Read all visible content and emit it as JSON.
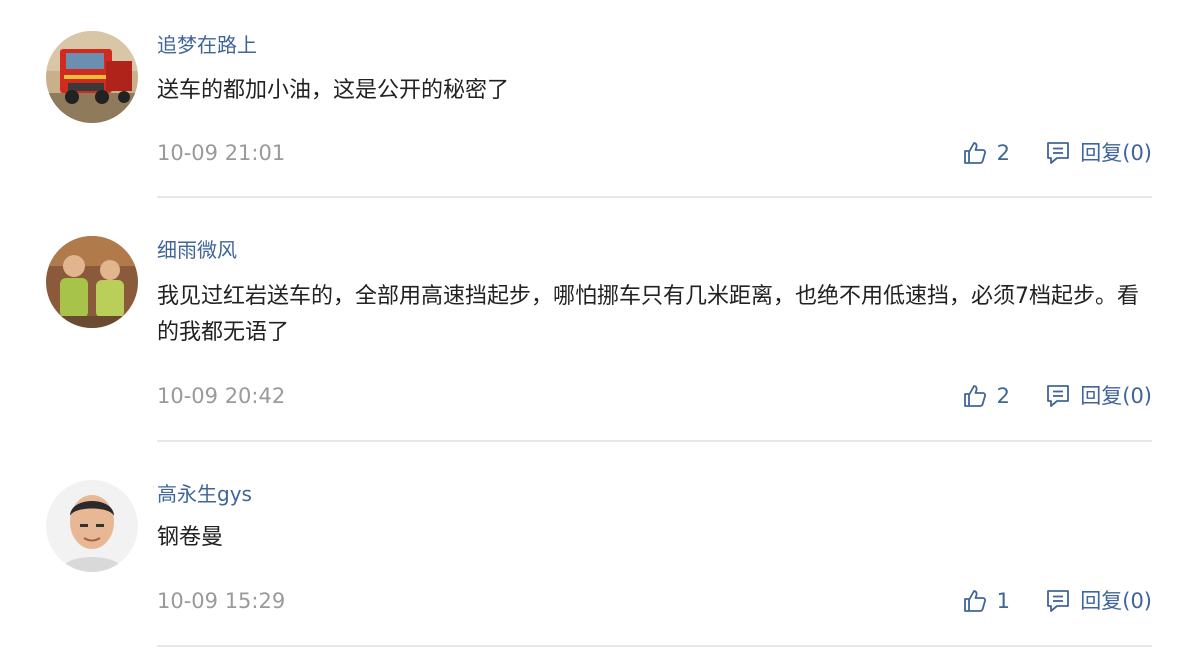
{
  "comments": [
    {
      "username": "追梦在路上",
      "content": "送车的都加小油，这是公开的秘密了",
      "timestamp": "10-09 21:01",
      "likes": "2",
      "reply_label": "回复(0)",
      "avatar": "red-truck-photo"
    },
    {
      "username": "细雨微风",
      "content": "我见过红岩送车的，全部用高速挡起步，哪怕挪车只有几米距离，也绝不用低速挡，必须7档起步。看的我都无语了",
      "timestamp": "10-09 20:42",
      "likes": "2",
      "reply_label": "回复(0)",
      "avatar": "two-children-photo"
    },
    {
      "username": "高永生gys",
      "content": "钢卷曼",
      "timestamp": "10-09 15:29",
      "likes": "1",
      "reply_label": "回复(0)",
      "avatar": "man-portrait-photo"
    }
  ],
  "icons": {
    "like": "thumbs-up-icon",
    "reply": "reply-comment-icon"
  },
  "colors": {
    "link": "#406599",
    "text": "#222222",
    "muted": "#9a9a9a",
    "divider": "#e8e8e8"
  }
}
